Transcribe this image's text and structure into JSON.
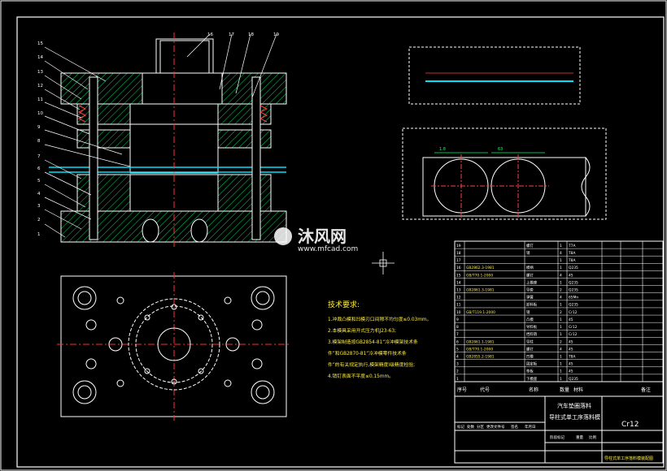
{
  "drawing": {
    "part_numbers": [
      "1",
      "2",
      "3",
      "4",
      "5",
      "6",
      "7",
      "8",
      "9",
      "10",
      "11",
      "12",
      "13",
      "14",
      "15",
      "16",
      "17",
      "18",
      "19"
    ],
    "strip_label": "",
    "strip_dim": "",
    "layout_label": "",
    "layout_dims": [
      "1.8",
      "63"
    ],
    "watermark_brand": "沐风网",
    "watermark_url": "www.mfcad.com",
    "tech_title": "技术要求:",
    "tech_lines": [
      "1.冲裁凸模和凹模刃口间隙不均匀度≤0.03mm。",
      "2.本模具采用开式压力机J23-63;",
      "3.模架制造按GB2854-81“冷冲模架技术条",
      "  件”和GB2870-81“冷冲模零件技术条",
      "  件”的有关规定执行,模架精度I级精度检验;",
      "4.销钉表面不平度≤0.15mm。"
    ],
    "bom_rows": [
      {
        "no": "19",
        "std": "",
        "name": "螺钉",
        "qty": "1",
        "mat": "T7A"
      },
      {
        "no": "18",
        "std": "",
        "name": "销",
        "qty": "4",
        "mat": "T8A"
      },
      {
        "no": "17",
        "std": "",
        "name": "",
        "qty": "1",
        "mat": "T8A"
      },
      {
        "no": "16",
        "std": "GB2862.3-1981",
        "name": "模柄",
        "qty": "1",
        "mat": "Q235"
      },
      {
        "no": "15",
        "std": "GB/T70.1-2000",
        "name": "螺钉",
        "qty": "4",
        "mat": "45"
      },
      {
        "no": "14",
        "std": "",
        "name": "上模座",
        "qty": "1",
        "mat": "Q235"
      },
      {
        "no": "13",
        "std": "GB2861.3-1981",
        "name": "导套",
        "qty": "2",
        "mat": "Q235"
      },
      {
        "no": "12",
        "std": "",
        "name": "弹簧",
        "qty": "4",
        "mat": "65Mn"
      },
      {
        "no": "11",
        "std": "",
        "name": "卸料板",
        "qty": "1",
        "mat": "Q235"
      },
      {
        "no": "10",
        "std": "GB/T119.1-2000",
        "name": "销",
        "qty": "2",
        "mat": "Cr12"
      },
      {
        "no": "9",
        "std": "",
        "name": "凸模",
        "qty": "1",
        "mat": "45"
      },
      {
        "no": "8",
        "std": "",
        "name": "导料板",
        "qty": "1",
        "mat": "Cr12"
      },
      {
        "no": "7",
        "std": "",
        "name": "挡料销",
        "qty": "1",
        "mat": "Cr12"
      },
      {
        "no": "6",
        "std": "GB2861.1-1981",
        "name": "导柱",
        "qty": "2",
        "mat": "45"
      },
      {
        "no": "5",
        "std": "GB/T70.1-2000",
        "name": "螺钉",
        "qty": "4",
        "mat": "45"
      },
      {
        "no": "4",
        "std": "GB2855.2-1981",
        "name": "凹模",
        "qty": "1",
        "mat": "T8A"
      },
      {
        "no": "3",
        "std": "",
        "name": "固定板",
        "qty": "1",
        "mat": "45"
      },
      {
        "no": "2",
        "std": "",
        "name": "垫板",
        "qty": "1",
        "mat": "45"
      },
      {
        "no": "1",
        "std": "",
        "name": "下模座",
        "qty": "1",
        "mat": "Q235"
      }
    ],
    "bom_header": {
      "no": "序号",
      "code": "代号",
      "name": "名称",
      "qty": "数量",
      "mat": "材料",
      "remark": "备注"
    },
    "title_main": "汽车垫圈落料",
    "title_sub": "导柱式单工序落料模",
    "material": "Cr12",
    "title_block_labels": [
      "标记",
      "处数",
      "分区",
      "更改文件号",
      "签名",
      "年月日"
    ],
    "stage_labels": [
      "阶段标记",
      "重量",
      "比例"
    ],
    "footer_text": "导柱式单工序落料模装配图"
  }
}
